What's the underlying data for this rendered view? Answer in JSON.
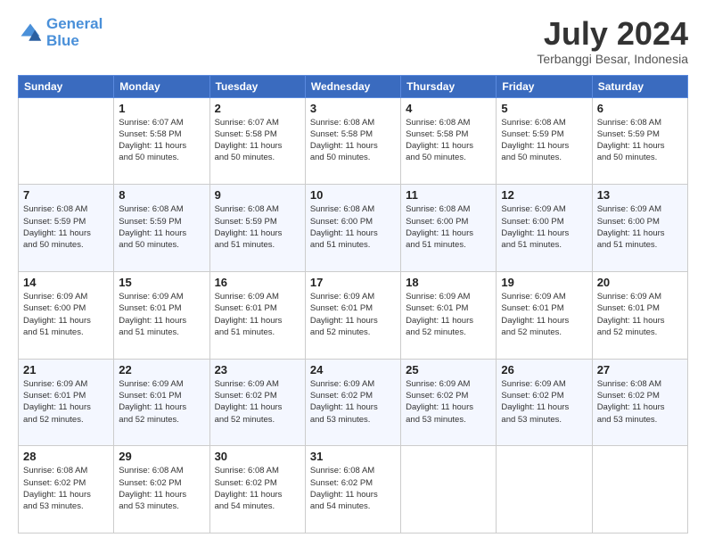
{
  "header": {
    "logo_line1": "General",
    "logo_line2": "Blue",
    "month": "July 2024",
    "location": "Terbanggi Besar, Indonesia"
  },
  "weekdays": [
    "Sunday",
    "Monday",
    "Tuesday",
    "Wednesday",
    "Thursday",
    "Friday",
    "Saturday"
  ],
  "weeks": [
    [
      {
        "day": "",
        "info": ""
      },
      {
        "day": "1",
        "info": "Sunrise: 6:07 AM\nSunset: 5:58 PM\nDaylight: 11 hours\nand 50 minutes."
      },
      {
        "day": "2",
        "info": "Sunrise: 6:07 AM\nSunset: 5:58 PM\nDaylight: 11 hours\nand 50 minutes."
      },
      {
        "day": "3",
        "info": "Sunrise: 6:08 AM\nSunset: 5:58 PM\nDaylight: 11 hours\nand 50 minutes."
      },
      {
        "day": "4",
        "info": "Sunrise: 6:08 AM\nSunset: 5:58 PM\nDaylight: 11 hours\nand 50 minutes."
      },
      {
        "day": "5",
        "info": "Sunrise: 6:08 AM\nSunset: 5:59 PM\nDaylight: 11 hours\nand 50 minutes."
      },
      {
        "day": "6",
        "info": "Sunrise: 6:08 AM\nSunset: 5:59 PM\nDaylight: 11 hours\nand 50 minutes."
      }
    ],
    [
      {
        "day": "7",
        "info": "Sunrise: 6:08 AM\nSunset: 5:59 PM\nDaylight: 11 hours\nand 50 minutes."
      },
      {
        "day": "8",
        "info": "Sunrise: 6:08 AM\nSunset: 5:59 PM\nDaylight: 11 hours\nand 50 minutes."
      },
      {
        "day": "9",
        "info": "Sunrise: 6:08 AM\nSunset: 5:59 PM\nDaylight: 11 hours\nand 51 minutes."
      },
      {
        "day": "10",
        "info": "Sunrise: 6:08 AM\nSunset: 6:00 PM\nDaylight: 11 hours\nand 51 minutes."
      },
      {
        "day": "11",
        "info": "Sunrise: 6:08 AM\nSunset: 6:00 PM\nDaylight: 11 hours\nand 51 minutes."
      },
      {
        "day": "12",
        "info": "Sunrise: 6:09 AM\nSunset: 6:00 PM\nDaylight: 11 hours\nand 51 minutes."
      },
      {
        "day": "13",
        "info": "Sunrise: 6:09 AM\nSunset: 6:00 PM\nDaylight: 11 hours\nand 51 minutes."
      }
    ],
    [
      {
        "day": "14",
        "info": "Sunrise: 6:09 AM\nSunset: 6:00 PM\nDaylight: 11 hours\nand 51 minutes."
      },
      {
        "day": "15",
        "info": "Sunrise: 6:09 AM\nSunset: 6:01 PM\nDaylight: 11 hours\nand 51 minutes."
      },
      {
        "day": "16",
        "info": "Sunrise: 6:09 AM\nSunset: 6:01 PM\nDaylight: 11 hours\nand 51 minutes."
      },
      {
        "day": "17",
        "info": "Sunrise: 6:09 AM\nSunset: 6:01 PM\nDaylight: 11 hours\nand 52 minutes."
      },
      {
        "day": "18",
        "info": "Sunrise: 6:09 AM\nSunset: 6:01 PM\nDaylight: 11 hours\nand 52 minutes."
      },
      {
        "day": "19",
        "info": "Sunrise: 6:09 AM\nSunset: 6:01 PM\nDaylight: 11 hours\nand 52 minutes."
      },
      {
        "day": "20",
        "info": "Sunrise: 6:09 AM\nSunset: 6:01 PM\nDaylight: 11 hours\nand 52 minutes."
      }
    ],
    [
      {
        "day": "21",
        "info": "Sunrise: 6:09 AM\nSunset: 6:01 PM\nDaylight: 11 hours\nand 52 minutes."
      },
      {
        "day": "22",
        "info": "Sunrise: 6:09 AM\nSunset: 6:01 PM\nDaylight: 11 hours\nand 52 minutes."
      },
      {
        "day": "23",
        "info": "Sunrise: 6:09 AM\nSunset: 6:02 PM\nDaylight: 11 hours\nand 52 minutes."
      },
      {
        "day": "24",
        "info": "Sunrise: 6:09 AM\nSunset: 6:02 PM\nDaylight: 11 hours\nand 53 minutes."
      },
      {
        "day": "25",
        "info": "Sunrise: 6:09 AM\nSunset: 6:02 PM\nDaylight: 11 hours\nand 53 minutes."
      },
      {
        "day": "26",
        "info": "Sunrise: 6:09 AM\nSunset: 6:02 PM\nDaylight: 11 hours\nand 53 minutes."
      },
      {
        "day": "27",
        "info": "Sunrise: 6:08 AM\nSunset: 6:02 PM\nDaylight: 11 hours\nand 53 minutes."
      }
    ],
    [
      {
        "day": "28",
        "info": "Sunrise: 6:08 AM\nSunset: 6:02 PM\nDaylight: 11 hours\nand 53 minutes."
      },
      {
        "day": "29",
        "info": "Sunrise: 6:08 AM\nSunset: 6:02 PM\nDaylight: 11 hours\nand 53 minutes."
      },
      {
        "day": "30",
        "info": "Sunrise: 6:08 AM\nSunset: 6:02 PM\nDaylight: 11 hours\nand 54 minutes."
      },
      {
        "day": "31",
        "info": "Sunrise: 6:08 AM\nSunset: 6:02 PM\nDaylight: 11 hours\nand 54 minutes."
      },
      {
        "day": "",
        "info": ""
      },
      {
        "day": "",
        "info": ""
      },
      {
        "day": "",
        "info": ""
      }
    ]
  ]
}
